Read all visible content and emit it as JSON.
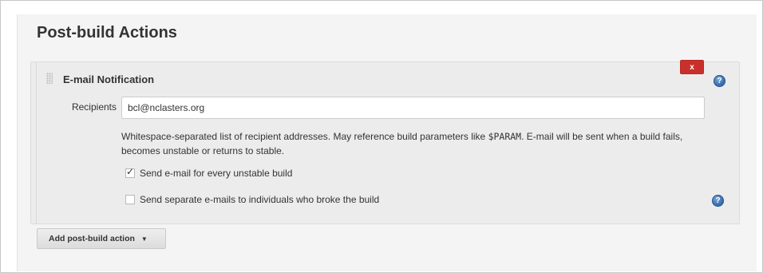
{
  "section": {
    "title": "Post-build Actions"
  },
  "step": {
    "title": "E-mail Notification",
    "delete_label": "x",
    "help_icon": "question-mark-icon",
    "recipients_label": "Recipients",
    "recipients_value": "bcl@nclasters.org",
    "help_text_before": "Whitespace-separated list of recipient addresses. May reference build parameters like ",
    "help_text_param": "$PARAM",
    "help_text_after": ". E-mail will be sent when a build fails, becomes unstable or returns to stable.",
    "options": [
      {
        "label": "Send e-mail for every unstable build",
        "checked": true
      },
      {
        "label": "Send separate e-mails to individuals who broke the build",
        "checked": false
      }
    ]
  },
  "add_action": {
    "label": "Add post-build action",
    "caret": "▼"
  },
  "colors": {
    "delete": "#c9302c",
    "help": "#3b6fb0",
    "panel": "#f4f4f4"
  }
}
